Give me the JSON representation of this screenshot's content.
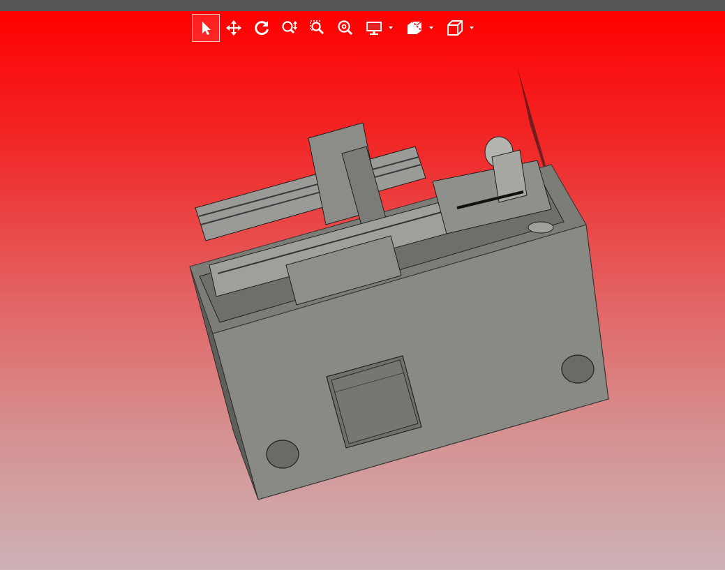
{
  "window": {
    "title": ""
  },
  "toolbar": {
    "tools": [
      {
        "name": "select",
        "icon": "cursor-arrow-icon",
        "active": true
      },
      {
        "name": "pan",
        "icon": "move-arrows-icon",
        "active": false
      },
      {
        "name": "rotate",
        "icon": "rotate-icon",
        "active": false
      },
      {
        "name": "zoom",
        "icon": "zoom-updown-icon",
        "active": false
      },
      {
        "name": "zoom-window",
        "icon": "zoom-window-icon",
        "active": false
      },
      {
        "name": "zoom-fit",
        "icon": "zoom-fit-icon",
        "active": false
      },
      {
        "name": "display",
        "icon": "monitor-icon",
        "dropdown": true
      },
      {
        "name": "section",
        "icon": "section-box-icon",
        "dropdown": true
      },
      {
        "name": "view",
        "icon": "cube-icon",
        "dropdown": true
      }
    ]
  },
  "viewport": {
    "background_top": "#ff0000",
    "background_bottom": "#cdb2b6",
    "model_color": "#8a8a85"
  }
}
